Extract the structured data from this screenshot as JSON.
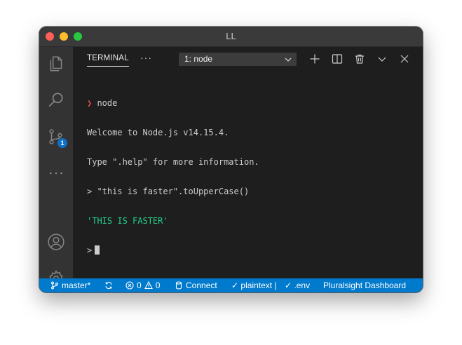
{
  "window": {
    "title": "LL"
  },
  "panel": {
    "tab_label": "TERMINAL",
    "more": "···",
    "terminal_select": "1: node"
  },
  "activity": {
    "source_control_badge": "1"
  },
  "terminal": {
    "lines": [
      {
        "prefix": "❯",
        "text": " node"
      },
      {
        "text": "Welcome to Node.js v14.15.4."
      },
      {
        "text": "Type \".help\" for more information."
      },
      {
        "text": "> \"this is faster\".toUpperCase()"
      },
      {
        "text": "'THIS IS FASTER'"
      },
      {
        "text": ">"
      }
    ]
  },
  "statusbar": {
    "branch": "master*",
    "errors": "0",
    "warnings": "0",
    "connect": "Connect",
    "plaintext": "✓ plaintext |",
    "env": "✓ .env",
    "dashboard": "Pluralsight Dashboard"
  },
  "colors": {
    "statusbar": "#007acc",
    "activitybar": "#333333",
    "editor_bg": "#1e1e1e",
    "prompt_red": "#f14c4c",
    "output_green": "#23d18b",
    "badge": "#0e71c5"
  }
}
